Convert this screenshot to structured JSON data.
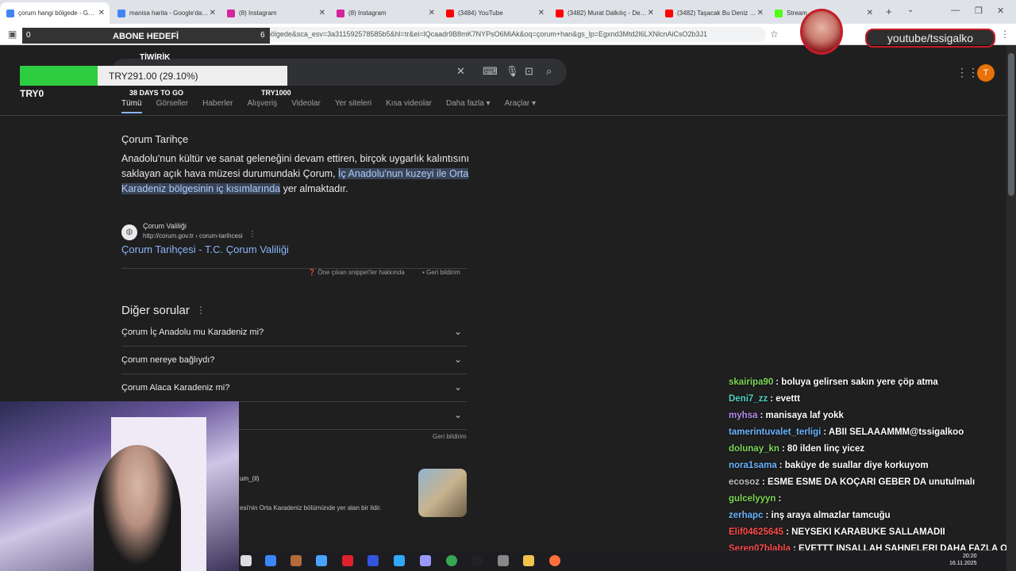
{
  "browser": {
    "tabs": [
      {
        "label": "çorum hangi bölgede - Goog",
        "favicon_color": "#4285f4",
        "active": true
      },
      {
        "label": "manisa harita - Google'da Ar",
        "favicon_color": "#4285f4",
        "active": false
      },
      {
        "label": "(8) Instagram",
        "favicon_color": "#d6249f",
        "active": false
      },
      {
        "label": "(8) Instagram",
        "favicon_color": "#d6249f",
        "active": false
      },
      {
        "label": "(3484) YouTube",
        "favicon_color": "#ff0000",
        "active": false
      },
      {
        "label": "(3482) Murat Dalkılıç - Derin",
        "favicon_color": "#ff0000",
        "active": false
      },
      {
        "label": "(3482) Taşacak Bu Deniz 6. B",
        "favicon_color": "#ff0000",
        "active": false
      },
      {
        "label": "Stream",
        "favicon_color": "#53fc18",
        "active": false
      }
    ],
    "url": "google.com/search?q=çorum+hangi+bölgede&sca_esv=3a311592578585b5&hl=tr&ei=lQcaadr9B8mK7NYPsO6MiAk&oq=çorum+han&gs_lp=Egxnd3Mtd2l6LXNlcnAiCsO2b3J1"
  },
  "google": {
    "tabs": [
      "Tümü",
      "Görseller",
      "Haberler",
      "Alışveriş",
      "Videolar",
      "Yer siteleri",
      "Kısa videolar",
      "Daha fazla ▾",
      "Araçlar ▾"
    ],
    "profile_initial": "T",
    "snippet": {
      "title": "Çorum Tarihçe",
      "text_before": "Anadolu'nun kültür ve sanat geleneğini devam ettiren, birçok uygarlık kalıntısını saklayan açık hava müzesi durumundaki Çorum, ",
      "text_highlight": "İç Anadolu'nun kuzeyi ile Orta Karadeniz bölgesinin iç kısımlarında",
      "text_after": " yer almaktadır.",
      "source_name": "Çorum Valiliği",
      "source_url": "http://corum.gov.tr › corum-tarihcesi",
      "link_title": "Çorum Tarihçesi - T.C. Çorum Valiliği",
      "about_label": "Öne çıkan snippet'ler hakkında",
      "feedback_label": "Geri bildirim"
    },
    "paa": {
      "title": "Diğer sorular",
      "questions": [
        "Çorum İç Anadolu mu Karadeniz mi?",
        "Çorum nereye bağlıydı?",
        "Çorum Alaca Karadeniz mi?",
        ""
      ],
      "feedback_label": "Geri bildirim"
    },
    "result2": {
      "source": "um_(il)",
      "text": "esi'nin Orta Karadeniz bölümünde yer alan bir ildir."
    }
  },
  "overlay": {
    "sub_goal": {
      "label": "ABONE HEDEFİ",
      "current": "0",
      "target": "6"
    },
    "donation": {
      "title": "TİWİRİK",
      "status": "TRY291.00 (29.10%)",
      "progress": 0.291,
      "min": "TRY0",
      "days": "38 DAYS TO GO",
      "max": "TRY1000",
      "color": "#2ecc40"
    },
    "channel": "youtube/tssigalko"
  },
  "chat": [
    {
      "user": "skairipa90",
      "color": "#7fd858",
      "text": ": boluya gelirsen sakın yere çöp atma"
    },
    {
      "user": "Deni7_zz",
      "color": "#4fd3c4",
      "text": ": evettt"
    },
    {
      "user": "myhsa",
      "color": "#b58cf0",
      "text": ": manisaya laf yokk"
    },
    {
      "user": "tamerintuvalet_terligi",
      "color": "#6bb5ff",
      "text": ": ABİİ SELAAAMMM@tssigalkoo"
    },
    {
      "user": "dolunay_kn",
      "color": "#7fd858",
      "text": ": 80 ilden linç yicez"
    },
    {
      "user": "nora1sama",
      "color": "#6bb5ff",
      "text": ": baküye de suallar diye korkuyom"
    },
    {
      "user": "ecosoz",
      "color": "#c0c0c0",
      "text": ": ESME ESME DA KOÇARİ GEBER DA unutulmalı"
    },
    {
      "user": "gulcelyyyn",
      "color": "#7fd858",
      "text": ":"
    },
    {
      "user": "zerhapc",
      "color": "#6bb5ff",
      "text": ": inş araya almazlar tamcuğu"
    },
    {
      "user": "Elif04625645",
      "color": "#ff4d4d",
      "text": ": NEYSEKİ KARABÜKE SALLAMADII"
    },
    {
      "user": "Seren07blabla",
      "color": "#ff4d4d",
      "text": ": EVETTT İNŞALLAH SAHNELERİ DAHA FAZLA OLUR EYÜPHAN SAHNESİ DE GEREKSİZDİ YA"
    }
  ],
  "taskbar": {
    "time": "20:20",
    "date": "16.11.2025"
  }
}
